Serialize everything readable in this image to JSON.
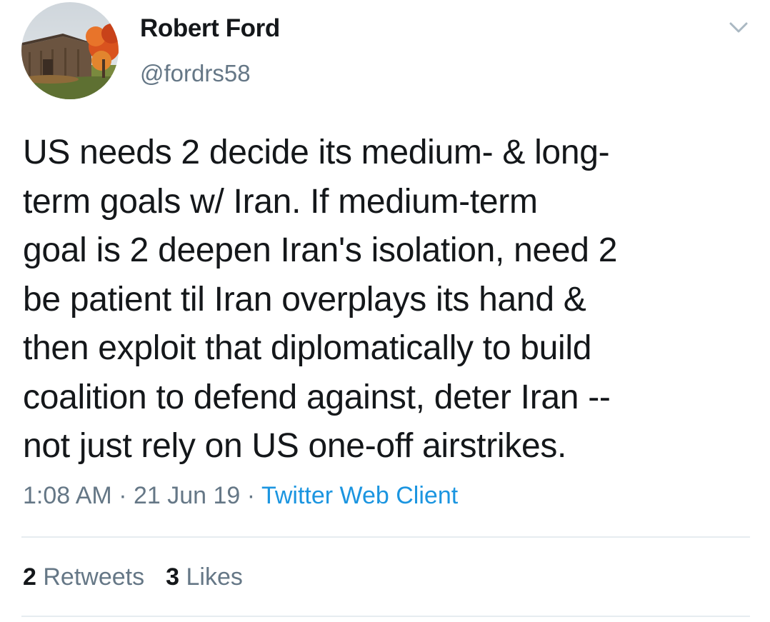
{
  "tweet": {
    "author": {
      "display_name": "Robert Ford",
      "handle": "@fordrs58"
    },
    "text": "US needs 2 decide its medium- & long-\nterm goals w/ Iran. If medium-term\ngoal is 2 deepen Iran's isolation, need 2\nbe patient til Iran overplays its hand &\nthen exploit that diplomatically to build\ncoalition to defend against, deter Iran --\nnot just rely on US one-off airstrikes.",
    "time": "1:08 AM",
    "separator": " · ",
    "date": "21 Jun 19",
    "source": "Twitter Web Client",
    "stats": {
      "retweets_count": "2",
      "retweets_label": "Retweets",
      "likes_count": "3",
      "likes_label": "Likes"
    }
  },
  "icons": {
    "menu": "chevron-down-icon"
  },
  "colors": {
    "text": "#14171a",
    "secondary": "#657786",
    "link": "#1b95e0",
    "divider": "#e6ecf0"
  }
}
